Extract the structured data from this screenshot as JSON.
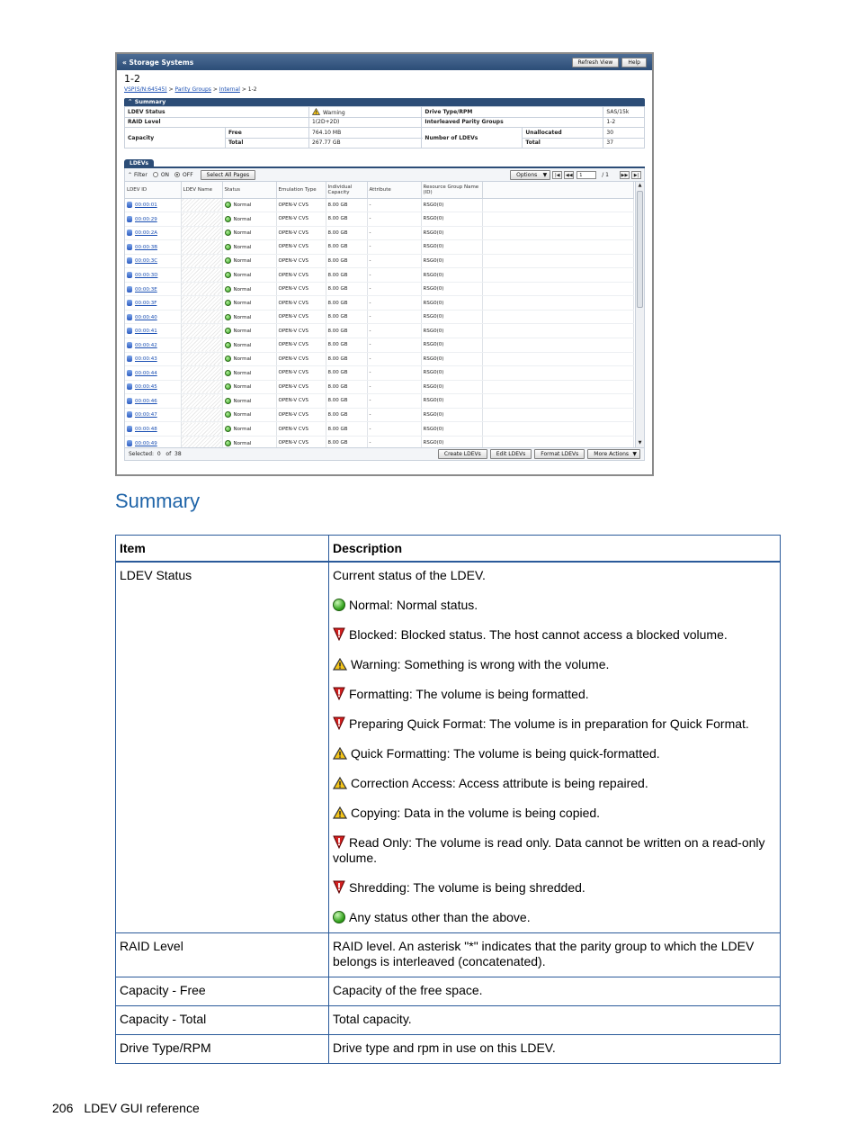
{
  "screenshot": {
    "window_title": "Storage Systems",
    "buttons": {
      "refresh": "Refresh View",
      "help": "Help"
    },
    "page_title": "1-2",
    "breadcrumb": [
      "VSP(S/N:64545)",
      ">",
      "Parity Groups",
      ">",
      "Internal",
      ">",
      "1-2"
    ],
    "summary_title": "Summary",
    "summary": {
      "ldev_status_label": "LDEV Status",
      "ldev_status_value": "Warning",
      "raid_level_label": "RAID Level",
      "raid_level_value": "1(2D+2D)",
      "capacity_label": "Capacity",
      "free_label": "Free",
      "free_value": "764.10 MB",
      "total_label": "Total",
      "total_value": "267.77 GB",
      "drive_type_label": "Drive Type/RPM",
      "drive_type_value": "SAS/15k",
      "interleaved_label": "Interleaved Parity Groups",
      "interleaved_value": "1-2",
      "num_ldevs_label": "Number of LDEVs",
      "unallocated_label": "Unallocated",
      "unallocated_value": "30",
      "ldev_total_label": "Total",
      "ldev_total_value": "37"
    },
    "tab": "LDEVs",
    "toolbar": {
      "filter": "Filter",
      "on": "ON",
      "off": "OFF",
      "select_all": "Select All Pages",
      "options": "Options",
      "page_current": "1",
      "page_total": "/ 1"
    },
    "columns": [
      "LDEV ID",
      "LDEV Name",
      "Status",
      "Emulation Type",
      "Individual Capacity",
      "Attribute",
      "Resource Group Name (ID)"
    ],
    "rows": [
      {
        "id": "00:00:01",
        "status": "Normal",
        "emulation": "OPEN-V CVS",
        "capacity": "8.00 GB",
        "attribute": "-",
        "rg": "RSG0(0)"
      },
      {
        "id": "00:00:29",
        "status": "Normal",
        "emulation": "OPEN-V CVS",
        "capacity": "8.00 GB",
        "attribute": "-",
        "rg": "RSG0(0)"
      },
      {
        "id": "00:00:2A",
        "status": "Normal",
        "emulation": "OPEN-V CVS",
        "capacity": "8.00 GB",
        "attribute": "-",
        "rg": "RSG0(0)"
      },
      {
        "id": "00:00:3B",
        "status": "Normal",
        "emulation": "OPEN-V CVS",
        "capacity": "8.00 GB",
        "attribute": "-",
        "rg": "RSG0(0)"
      },
      {
        "id": "00:00:3C",
        "status": "Normal",
        "emulation": "OPEN-V CVS",
        "capacity": "8.00 GB",
        "attribute": "-",
        "rg": "RSG0(0)"
      },
      {
        "id": "00:00:3D",
        "status": "Normal",
        "emulation": "OPEN-V CVS",
        "capacity": "8.00 GB",
        "attribute": "-",
        "rg": "RSG0(0)"
      },
      {
        "id": "00:00:3E",
        "status": "Normal",
        "emulation": "OPEN-V CVS",
        "capacity": "8.00 GB",
        "attribute": "-",
        "rg": "RSG0(0)"
      },
      {
        "id": "00:00:3F",
        "status": "Normal",
        "emulation": "OPEN-V CVS",
        "capacity": "8.00 GB",
        "attribute": "-",
        "rg": "RSG0(0)"
      },
      {
        "id": "00:00:40",
        "status": "Normal",
        "emulation": "OPEN-V CVS",
        "capacity": "8.00 GB",
        "attribute": "-",
        "rg": "RSG0(0)"
      },
      {
        "id": "00:00:41",
        "status": "Normal",
        "emulation": "OPEN-V CVS",
        "capacity": "8.00 GB",
        "attribute": "-",
        "rg": "RSG0(0)"
      },
      {
        "id": "00:00:42",
        "status": "Normal",
        "emulation": "OPEN-V CVS",
        "capacity": "8.00 GB",
        "attribute": "-",
        "rg": "RSG0(0)"
      },
      {
        "id": "00:00:43",
        "status": "Normal",
        "emulation": "OPEN-V CVS",
        "capacity": "8.00 GB",
        "attribute": "-",
        "rg": "RSG0(0)"
      },
      {
        "id": "00:00:44",
        "status": "Normal",
        "emulation": "OPEN-V CVS",
        "capacity": "8.00 GB",
        "attribute": "-",
        "rg": "RSG0(0)"
      },
      {
        "id": "00:00:45",
        "status": "Normal",
        "emulation": "OPEN-V CVS",
        "capacity": "8.00 GB",
        "attribute": "-",
        "rg": "RSG0(0)"
      },
      {
        "id": "00:00:46",
        "status": "Normal",
        "emulation": "OPEN-V CVS",
        "capacity": "8.00 GB",
        "attribute": "-",
        "rg": "RSG0(0)"
      },
      {
        "id": "00:00:47",
        "status": "Normal",
        "emulation": "OPEN-V CVS",
        "capacity": "8.00 GB",
        "attribute": "-",
        "rg": "RSG0(0)"
      },
      {
        "id": "00:00:48",
        "status": "Normal",
        "emulation": "OPEN-V CVS",
        "capacity": "8.00 GB",
        "attribute": "-",
        "rg": "RSG0(0)"
      },
      {
        "id": "00:00:49",
        "status": "Normal",
        "emulation": "OPEN-V CVS",
        "capacity": "8.00 GB",
        "attribute": "-",
        "rg": "RSG0(0)"
      }
    ],
    "footer": {
      "selected_label": "Selected:",
      "selected_count": "0",
      "of_label": "of",
      "total": "38",
      "create": "Create LDEVs",
      "edit": "Edit LDEVs",
      "format": "Format LDEVs",
      "more": "More Actions"
    }
  },
  "section_title": "Summary",
  "table": {
    "header_item": "Item",
    "header_description": "Description",
    "ldev_status": {
      "item": "LDEV Status",
      "intro": "Current status of the LDEV.",
      "statuses": [
        {
          "icon": "normal",
          "text": "Normal: Normal status."
        },
        {
          "icon": "blocked",
          "text": "Blocked: Blocked status. The host cannot access a blocked volume."
        },
        {
          "icon": "warning",
          "text": "Warning: Something is wrong with the volume."
        },
        {
          "icon": "blocked",
          "text": "Formatting: The volume is being formatted."
        },
        {
          "icon": "blocked",
          "text": "Preparing Quick Format: The volume is in preparation for Quick Format."
        },
        {
          "icon": "warning",
          "text": "Quick Formatting: The volume is being quick-formatted."
        },
        {
          "icon": "warning",
          "text": "Correction Access: Access attribute is being repaired."
        },
        {
          "icon": "warning",
          "text": "Copying: Data in the volume is being copied."
        },
        {
          "icon": "blocked",
          "text": "Read Only: The volume is read only. Data cannot be written on a read-only volume."
        },
        {
          "icon": "blocked",
          "text": "Shredding: The volume is being shredded."
        },
        {
          "icon": "normal",
          "text": "Any status other than the above."
        }
      ]
    },
    "rows": [
      {
        "item": "RAID Level",
        "description": "RAID level. An asterisk \"*\" indicates that the parity group to which the LDEV belongs is interleaved (concatenated)."
      },
      {
        "item": "Capacity - Free",
        "description": "Capacity of the free space."
      },
      {
        "item": "Capacity - Total",
        "description": "Total capacity."
      },
      {
        "item": "Drive Type/RPM",
        "description": "Drive type and rpm in use on this LDEV."
      }
    ]
  },
  "page_footer": {
    "page_number": "206",
    "section": "LDEV GUI reference"
  }
}
